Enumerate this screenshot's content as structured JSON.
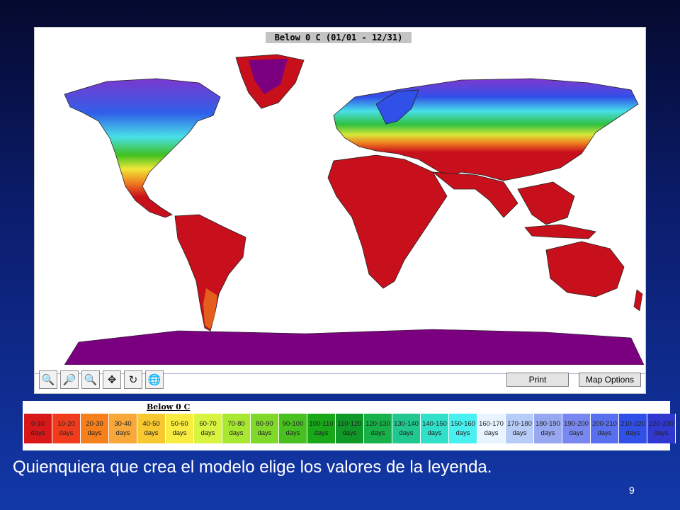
{
  "map": {
    "title": "Below 0 C (01/01 - 12/31)",
    "land_color": "#c8101c",
    "ocean_color": "#ffffff",
    "ice_color": "#7a0080"
  },
  "toolbar": {
    "tools": [
      {
        "name": "zoom-in-icon",
        "glyph": "🔍"
      },
      {
        "name": "zoom-box-icon",
        "glyph": "🔎"
      },
      {
        "name": "zoom-out-icon",
        "glyph": "🔍"
      },
      {
        "name": "pan-icon",
        "glyph": "✥"
      },
      {
        "name": "refresh-icon",
        "glyph": "↻"
      },
      {
        "name": "globe-icon",
        "glyph": "🌐"
      }
    ],
    "print_label": "Print",
    "map_options_label": "Map Options"
  },
  "legend": {
    "title": "Below 0 C",
    "items": [
      {
        "label": "0-10 days",
        "color": "#d81818"
      },
      {
        "label": "10-20 days",
        "color": "#f03c1c"
      },
      {
        "label": "20-30 days",
        "color": "#f8801c"
      },
      {
        "label": "30-40 days",
        "color": "#f8a838"
      },
      {
        "label": "40-50 days",
        "color": "#f8c830"
      },
      {
        "label": "50-60 days",
        "color": "#f8ec40"
      },
      {
        "label": "60-70 days",
        "color": "#d8f440"
      },
      {
        "label": "70-80 days",
        "color": "#a8e830"
      },
      {
        "label": "80-90 days",
        "color": "#80d828"
      },
      {
        "label": "90-100 days",
        "color": "#48c020"
      },
      {
        "label": "100-110 days",
        "color": "#18a818"
      },
      {
        "label": "110-120 days",
        "color": "#109828"
      },
      {
        "label": "120-130 days",
        "color": "#18b048"
      },
      {
        "label": "130-140 days",
        "color": "#20c890"
      },
      {
        "label": "140-150 days",
        "color": "#30e0c8"
      },
      {
        "label": "150-160 days",
        "color": "#48f0f0"
      },
      {
        "label": "160-170 days",
        "color": "#e8f4ff"
      },
      {
        "label": "170-180 days",
        "color": "#b8ccf8"
      },
      {
        "label": "180-190 days",
        "color": "#98a8f0"
      },
      {
        "label": "190-200 days",
        "color": "#7888f0"
      },
      {
        "label": "200-210 days",
        "color": "#5870f0"
      },
      {
        "label": "210-220 days",
        "color": "#3050e8"
      },
      {
        "label": "220-230 days",
        "color": "#3038d0"
      }
    ]
  },
  "caption": "Quienquiera que crea el modelo elige los valores de la leyenda.",
  "page_number": "9"
}
